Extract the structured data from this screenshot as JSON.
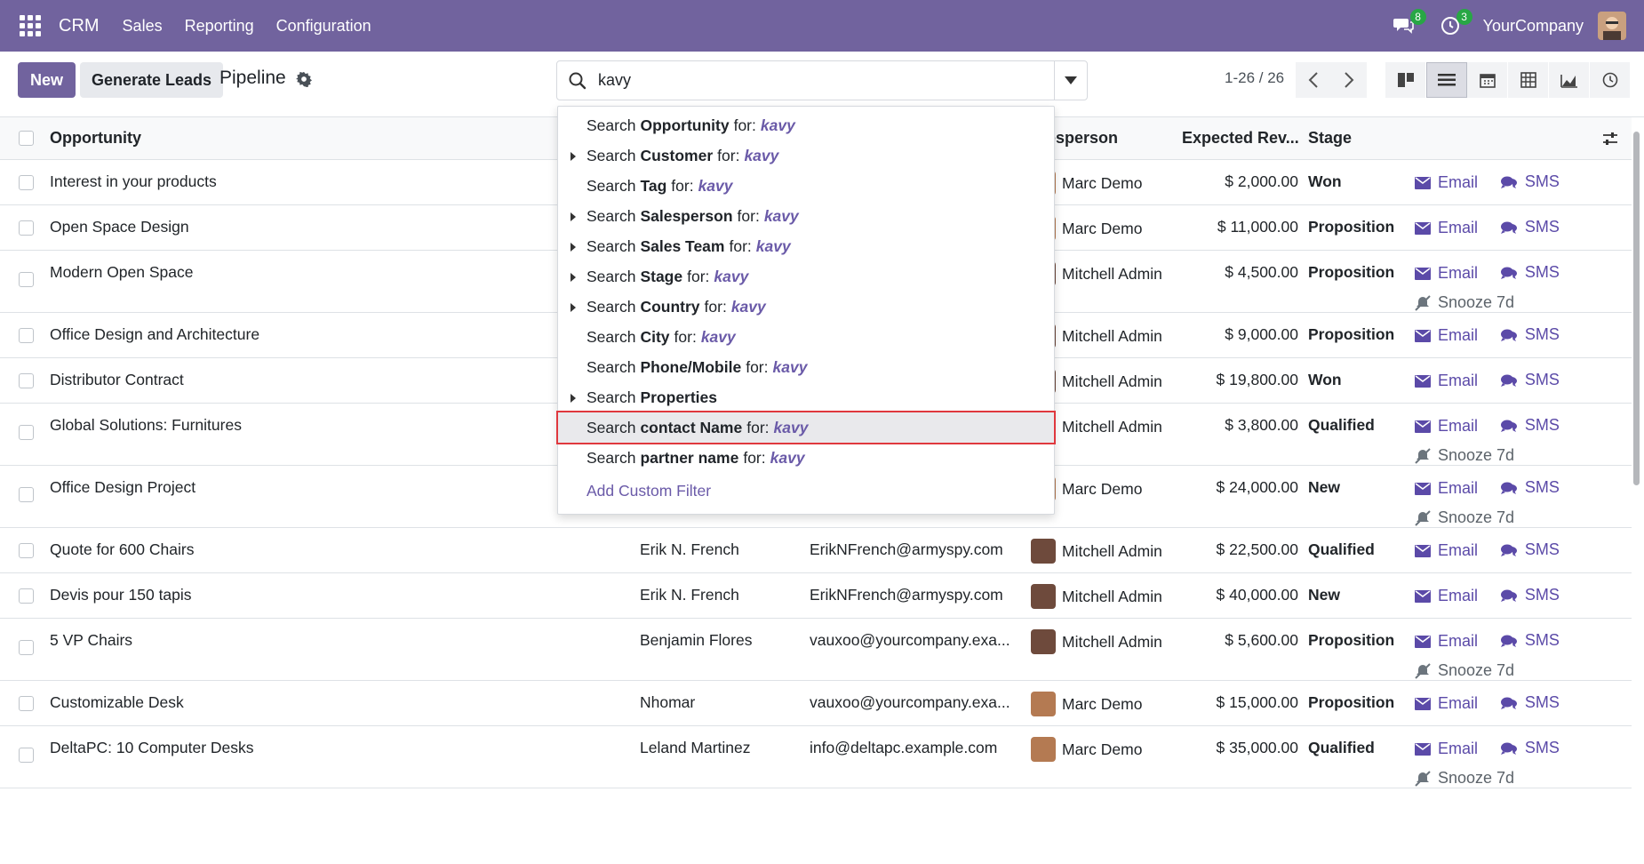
{
  "nav": {
    "brand": "CRM",
    "menus": [
      "Sales",
      "Reporting",
      "Configuration"
    ],
    "messages_badge": "8",
    "activities_badge": "3",
    "company": "YourCompany"
  },
  "control": {
    "new_label": "New",
    "generate_label": "Generate Leads",
    "breadcrumb": "Pipeline",
    "search_value": "kavy",
    "pager": "1-26 / 26"
  },
  "columns": {
    "opportunity": "Opportunity",
    "salesperson": "esperson",
    "revenue": "Expected Rev...",
    "stage": "Stage"
  },
  "actions": {
    "email": "Email",
    "sms": "SMS",
    "snooze": "Snooze 7d"
  },
  "rows": [
    {
      "opp": "Interest in your products",
      "cust": "",
      "mail": "",
      "sp": "Marc Demo",
      "rev": "$ 2,000.00",
      "stage": "Won",
      "snooze": false
    },
    {
      "opp": "Open Space Design",
      "cust": "",
      "mail": "",
      "sp": "Marc Demo",
      "rev": "$ 11,000.00",
      "stage": "Proposition",
      "snooze": false
    },
    {
      "opp": "Modern Open Space",
      "cust": "",
      "mail": "",
      "sp": "Mitchell Admin",
      "rev": "$ 4,500.00",
      "stage": "Proposition",
      "snooze": true
    },
    {
      "opp": "Office Design and Architecture",
      "cust": "",
      "mail": "",
      "sp": "Mitchell Admin",
      "rev": "$ 9,000.00",
      "stage": "Proposition",
      "snooze": false
    },
    {
      "opp": "Distributor Contract",
      "cust": "",
      "mail": "",
      "sp": "Mitchell Admin",
      "rev": "$ 19,800.00",
      "stage": "Won",
      "snooze": false
    },
    {
      "opp": "Global Solutions: Furnitures",
      "cust": "",
      "mail": "",
      "sp": "Mitchell Admin",
      "rev": "$ 3,800.00",
      "stage": "Qualified",
      "snooze": true
    },
    {
      "opp": "Office Design Project",
      "cust": "",
      "mail": "",
      "sp": "Marc Demo",
      "rev": "$ 24,000.00",
      "stage": "New",
      "snooze": true
    },
    {
      "opp": "Quote for 600 Chairs",
      "cust": "Erik N. French",
      "mail": "ErikNFrench@armyspy.com",
      "sp": "Mitchell Admin",
      "rev": "$ 22,500.00",
      "stage": "Qualified",
      "snooze": false
    },
    {
      "opp": "Devis pour 150 tapis",
      "cust": "Erik N. French",
      "mail": "ErikNFrench@armyspy.com",
      "sp": "Mitchell Admin",
      "rev": "$ 40,000.00",
      "stage": "New",
      "snooze": false
    },
    {
      "opp": "5 VP Chairs",
      "cust": "Benjamin Flores",
      "mail": "vauxoo@yourcompany.exa...",
      "sp": "Mitchell Admin",
      "rev": "$ 5,600.00",
      "stage": "Proposition",
      "snooze": true
    },
    {
      "opp": "Customizable Desk",
      "cust": "Nhomar",
      "mail": "vauxoo@yourcompany.exa...",
      "sp": "Marc Demo",
      "rev": "$ 15,000.00",
      "stage": "Proposition",
      "snooze": false
    },
    {
      "opp": "DeltaPC: 10 Computer Desks",
      "cust": "Leland Martinez",
      "mail": "info@deltapc.example.com",
      "sp": "Marc Demo",
      "rev": "$ 35,000.00",
      "stage": "Qualified",
      "snooze": true
    }
  ],
  "dropdown": {
    "term": "kavy",
    "items": [
      {
        "pre": "Search",
        "field": "Opportunity",
        "post": "for:",
        "caret": false
      },
      {
        "pre": "Search",
        "field": "Customer",
        "post": "for:",
        "caret": true
      },
      {
        "pre": "Search",
        "field": "Tag",
        "post": "for:",
        "caret": false
      },
      {
        "pre": "Search",
        "field": "Salesperson",
        "post": "for:",
        "caret": true
      },
      {
        "pre": "Search",
        "field": "Sales Team",
        "post": "for:",
        "caret": true
      },
      {
        "pre": "Search",
        "field": "Stage",
        "post": "for:",
        "caret": true
      },
      {
        "pre": "Search",
        "field": "Country",
        "post": "for:",
        "caret": true
      },
      {
        "pre": "Search",
        "field": "City",
        "post": "for:",
        "caret": false
      },
      {
        "pre": "Search",
        "field": "Phone/Mobile",
        "post": "for:",
        "caret": false
      },
      {
        "pre": "Search",
        "field": "Properties",
        "post": "",
        "caret": true
      },
      {
        "pre": "Search",
        "field": "contact Name",
        "post": "for:",
        "caret": false,
        "highlight": true
      },
      {
        "pre": "Search",
        "field": "partner name",
        "post": "for:",
        "caret": false
      }
    ],
    "custom_filter": "Add Custom Filter"
  }
}
